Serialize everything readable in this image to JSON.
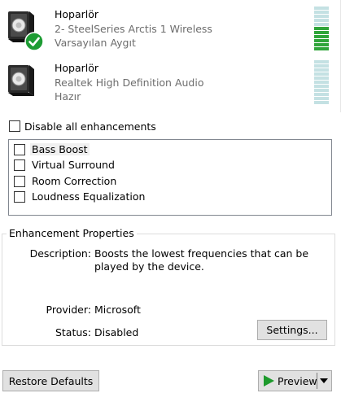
{
  "devices": [
    {
      "name": "Hoparlör",
      "description": "2- SteelSeries Arctis 1 Wireless",
      "status": "Varsayılan Aygıt",
      "is_default": true,
      "level_segments_active": 6,
      "level_segments_total": 11
    },
    {
      "name": "Hoparlör",
      "description": "Realtek High Definition Audio",
      "status": "Hazır",
      "is_default": false,
      "level_segments_active": 0,
      "level_segments_total": 11
    }
  ],
  "disable_all": {
    "label": "Disable all enhancements",
    "checked": false
  },
  "enhancements": [
    {
      "label": "Bass Boost",
      "checked": false,
      "selected": true
    },
    {
      "label": "Virtual Surround",
      "checked": false,
      "selected": false
    },
    {
      "label": "Room Correction",
      "checked": false,
      "selected": false
    },
    {
      "label": "Loudness Equalization",
      "checked": false,
      "selected": false
    }
  ],
  "properties": {
    "group_title": "Enhancement Properties",
    "description_label": "Description:",
    "description_value": "Boosts the lowest frequencies that can be played by the device.",
    "provider_label": "Provider:",
    "provider_value": "Microsoft",
    "status_label": "Status:",
    "status_value": "Disabled",
    "settings_button": "Settings..."
  },
  "footer": {
    "restore_button": "Restore Defaults",
    "preview_button": "Preview"
  },
  "colors": {
    "meter_active": "#2fa53a",
    "meter_inactive": "#c4e1e3",
    "check_badge": "#1e9c34",
    "play_icon": "#1d9a2c"
  },
  "icons": {
    "speaker": "speaker-icon",
    "default_badge": "check-badge-icon",
    "play": "play-icon",
    "dropdown": "chevron-down-icon"
  }
}
